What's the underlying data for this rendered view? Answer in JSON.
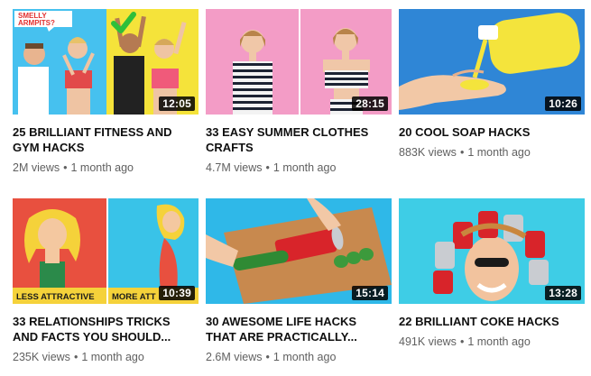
{
  "videos": [
    {
      "title_line1": "25 BRILLIANT FITNESS AND",
      "title_line2": "GYM HACKS",
      "views": "2M views",
      "age": "1 month ago",
      "duration": "12:05",
      "thumb_text": "SMELLY ARMPITS?",
      "thumb_text_a": "SMELLY",
      "thumb_text_b": "ARMPITS?"
    },
    {
      "title_line1": "33 EASY SUMMER CLOTHES",
      "title_line2": "CRAFTS",
      "views": "4.7M views",
      "age": "1 month ago",
      "duration": "28:15"
    },
    {
      "title_line1": "20 COOL SOAP HACKS",
      "title_line2": "",
      "views": "883K views",
      "age": "1 month ago",
      "duration": "10:26"
    },
    {
      "title_line1": "33 RELATIONSHIPS TRICKS",
      "title_line2": "AND FACTS YOU SHOULD...",
      "views": "235K views",
      "age": "1 month ago",
      "duration": "10:39",
      "thumb_left_label": "LESS ATTRACTIVE",
      "thumb_right_label": "MORE ATT"
    },
    {
      "title_line1": "30 AWESOME LIFE HACKS",
      "title_line2": "THAT ARE PRACTICALLY...",
      "views": "2.6M views",
      "age": "1 month ago",
      "duration": "15:14"
    },
    {
      "title_line1": "22 BRILLIANT COKE HACKS",
      "title_line2": "",
      "views": "491K views",
      "age": "1 month ago",
      "duration": "13:28"
    }
  ],
  "separator": "•",
  "colors": {
    "title": "#0f0f0f",
    "meta": "#606060",
    "duration_bg": "#000000",
    "pink": "#f29ac4",
    "blue": "#3a8fd9",
    "yellow": "#f6e14a",
    "cyan": "#3ad0e8",
    "green": "#2d9b5f"
  }
}
